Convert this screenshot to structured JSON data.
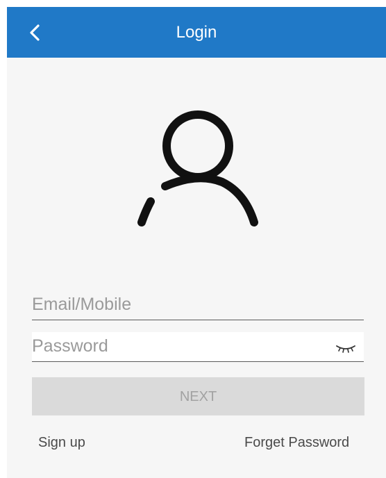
{
  "header": {
    "title": "Login",
    "back_icon": "chevron-left-icon",
    "background_color": "#2079c7"
  },
  "avatar": {
    "icon": "user-icon"
  },
  "form": {
    "email_placeholder": "Email/Mobile",
    "email_value": "",
    "password_placeholder": "Password",
    "password_value": "",
    "eye_icon": "eye-closed-icon"
  },
  "actions": {
    "next_label": "NEXT",
    "next_disabled": true
  },
  "links": {
    "signup_label": "Sign up",
    "forget_label": "Forget Password"
  }
}
